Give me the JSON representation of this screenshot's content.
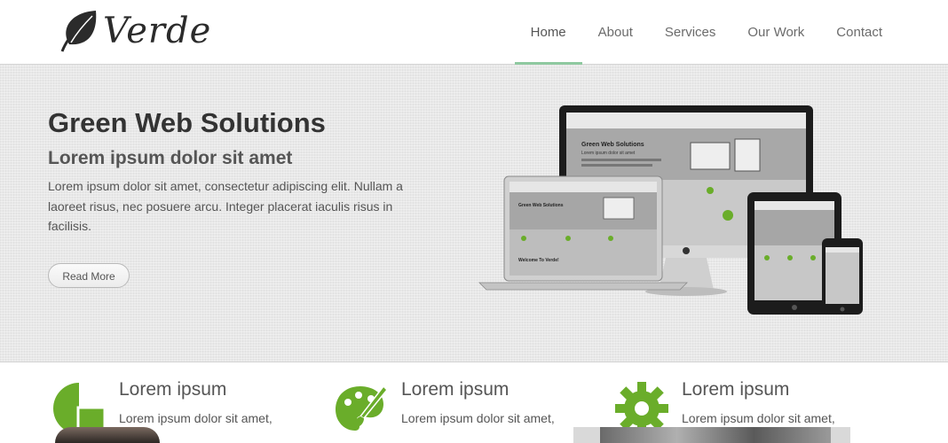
{
  "brand": {
    "name": "Verde"
  },
  "nav": {
    "items": [
      {
        "label": "Home",
        "active": true
      },
      {
        "label": "About",
        "active": false
      },
      {
        "label": "Services",
        "active": false
      },
      {
        "label": "Our Work",
        "active": false
      },
      {
        "label": "Contact",
        "active": false
      }
    ]
  },
  "hero": {
    "title": "Green Web Solutions",
    "subtitle": "Lorem ipsum dolor sit amet",
    "text": "Lorem ipsum dolor sit amet, consectetur adipiscing elit. Nullam a laoreet risus, nec posuere arcu. Integer placerat iaculis risus in facilisis.",
    "button_label": "Read More",
    "devices_image": {
      "icon": "responsive-devices-mockup",
      "screen_title": "Green Web Solutions",
      "screen_subtitle": "Lorem ipsum dolor sit amet",
      "screen_welcome": "Welcome To Verde!"
    }
  },
  "features": [
    {
      "icon": "pie-chart-icon",
      "title": "Lorem ipsum",
      "text": "Lorem ipsum dolor sit amet,"
    },
    {
      "icon": "palette-brush-icon",
      "title": "Lorem ipsum",
      "text": "Lorem ipsum dolor sit amet,"
    },
    {
      "icon": "gear-icon",
      "title": "Lorem ipsum",
      "text": "Lorem ipsum dolor sit amet,"
    }
  ],
  "colors": {
    "accent_green": "#6aad2a",
    "nav_active_underline": "#8fc9a0",
    "hero_background": "#e8e8e8"
  }
}
